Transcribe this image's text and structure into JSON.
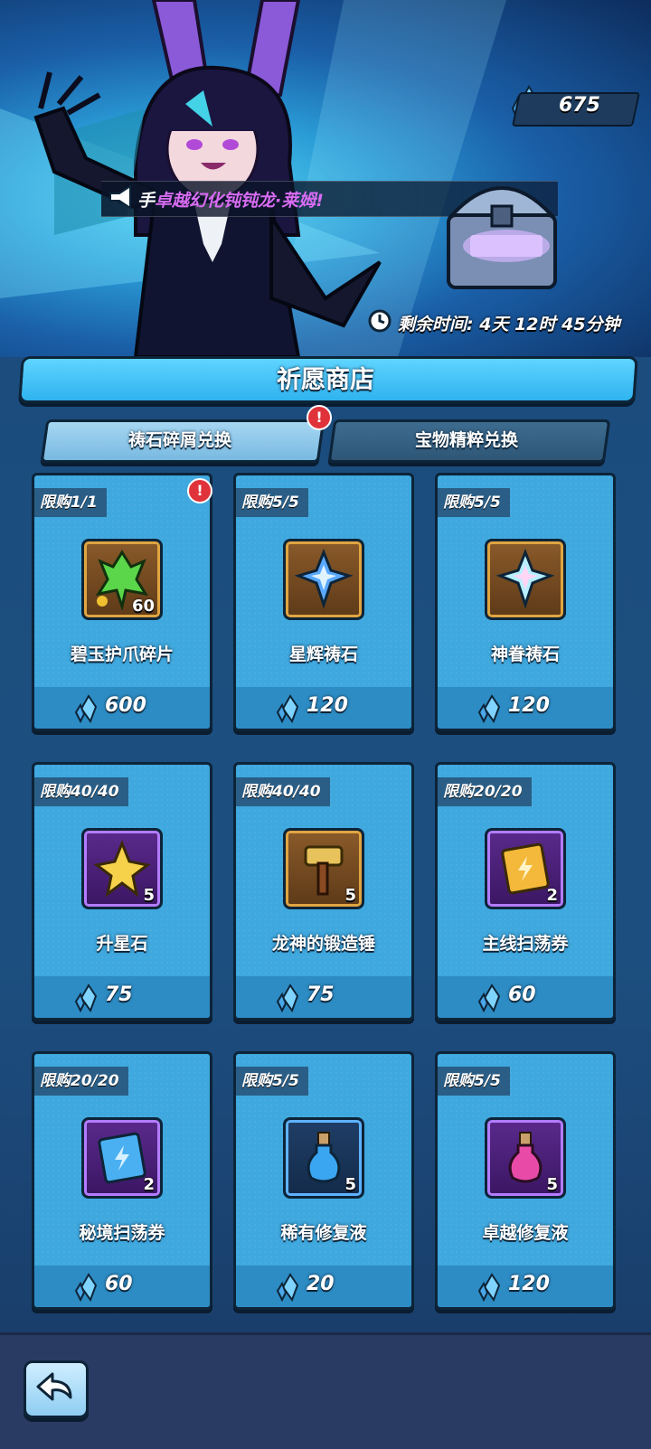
{
  "header": {
    "currency_amount": "675",
    "announcement": "卓越幻化钝钝龙·莱姆!",
    "announcement_prefix": "手",
    "timer_label": "剩余时间:",
    "timer_value": "4天 12时 45分钟"
  },
  "shop": {
    "title": "祈愿商店",
    "tabs": [
      {
        "label": "祷石碎屑兑换",
        "active": true,
        "alert": "!"
      },
      {
        "label": "宝物精粹兑换",
        "active": false
      }
    ],
    "items": [
      {
        "limit": "限购1/1",
        "name": "碧玉护爪碎片",
        "qty": "60",
        "price": "600",
        "frame": "gold",
        "icon": "jade-claw-fragment-icon",
        "alert": "!"
      },
      {
        "limit": "限购5/5",
        "name": "星辉祷石",
        "qty": "",
        "price": "120",
        "frame": "gold",
        "icon": "star-prayer-stone-icon"
      },
      {
        "limit": "限购5/5",
        "name": "神眷祷石",
        "qty": "",
        "price": "120",
        "frame": "gold",
        "icon": "divine-prayer-stone-icon"
      },
      {
        "limit": "限购40/40",
        "name": "升星石",
        "qty": "5",
        "price": "75",
        "frame": "purple",
        "icon": "star-stone-icon"
      },
      {
        "limit": "限购40/40",
        "name": "龙神的锻造锤",
        "qty": "5",
        "price": "75",
        "frame": "gold",
        "icon": "forge-hammer-icon"
      },
      {
        "limit": "限购20/20",
        "name": "主线扫荡券",
        "qty": "2",
        "price": "60",
        "frame": "purple",
        "icon": "main-sweep-ticket-icon"
      },
      {
        "limit": "限购20/20",
        "name": "秘境扫荡券",
        "qty": "2",
        "price": "60",
        "frame": "purple",
        "icon": "realm-sweep-ticket-icon"
      },
      {
        "limit": "限购5/5",
        "name": "稀有修复液",
        "qty": "5",
        "price": "20",
        "frame": "blue",
        "icon": "rare-potion-icon"
      },
      {
        "limit": "限购5/5",
        "name": "卓越修复液",
        "qty": "5",
        "price": "120",
        "frame": "purple",
        "icon": "epic-potion-icon"
      }
    ]
  },
  "colors": {
    "card": "#3fa8de",
    "accent": "#2fb3ef",
    "announce_text": "#d86cf2"
  }
}
